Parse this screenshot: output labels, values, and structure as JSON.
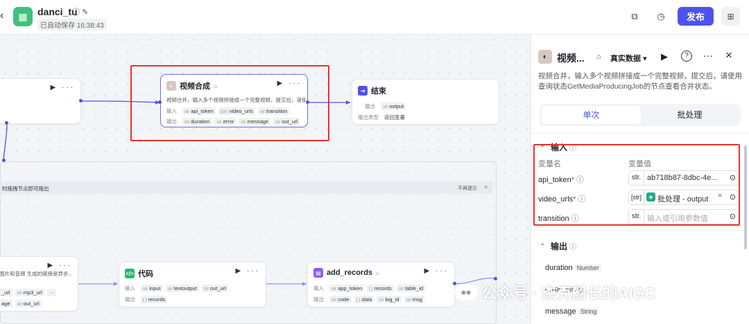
{
  "header": {
    "app_name": "danci_tu",
    "autosave": "已自动保存 16:38:43",
    "publish": "发布",
    "info_glyph": "ⓘ",
    "edit_glyph": "✎"
  },
  "canvas": {
    "hint": "时拖拽节点即可拖出",
    "hint_close": "不再提示",
    "video_node": {
      "title": "视频合成",
      "desc": "视频合并，输入多个视频拼接成一个完整视频，提交后，请使...",
      "in_label": "输入",
      "out_label": "输出",
      "inputs": [
        {
          "type": "str",
          "name": "api_token"
        },
        {
          "type": "[str]",
          "name": "video_urls"
        },
        {
          "type": "str",
          "name": "transition"
        }
      ],
      "outputs": [
        {
          "type": "Int",
          "name": "duration"
        },
        {
          "type": "str",
          "name": "error"
        },
        {
          "type": "str",
          "name": "message"
        },
        {
          "type": "str",
          "name": "out_url"
        }
      ]
    },
    "end_node": {
      "title": "结束",
      "out_label": "输出",
      "out_tag_type": "str",
      "out_tag": "output",
      "type_label": "输出类型",
      "type_value": "返回变量"
    },
    "code_node": {
      "title": "代码",
      "in_label": "输入",
      "out_label": "输出",
      "inputs": [
        {
          "type": "str",
          "name": "input"
        },
        {
          "type": "str",
          "name": "textoutput"
        },
        {
          "type": "str",
          "name": "out_url"
        }
      ],
      "outputs": [
        {
          "type": "[ ]",
          "name": "records"
        }
      ]
    },
    "records_node": {
      "title": "add_records",
      "in_label": "输入",
      "out_label": "输出",
      "inputs": [
        {
          "type": "str",
          "name": "app_token"
        },
        {
          "type": "[ ]",
          "name": "records"
        },
        {
          "type": "str",
          "name": "table_id"
        }
      ],
      "outputs": [
        {
          "type": "Int",
          "name": "code"
        },
        {
          "type": "{ }",
          "name": "data"
        },
        {
          "type": "str",
          "name": "log_id"
        },
        {
          "type": "str",
          "name": "msg"
        }
      ]
    },
    "left_node": {
      "desc": "图片和音频 生成的链接是异步...",
      "row1": [
        {
          "type": "",
          "name": "_url"
        },
        {
          "type": "str",
          "name": "mp3_url"
        }
      ],
      "row2": [
        {
          "type": "",
          "name": "age"
        },
        {
          "type": "str",
          "name": "out_url"
        }
      ]
    }
  },
  "panel": {
    "title": "视频...",
    "data_mode": "真实数据",
    "desc": "视频合并，输入多个视频拼接成一个完整视频，提交后，请使用查询状态GetMediaProducingJob的节点查看合并状态。",
    "tabs": [
      "单次",
      "批处理"
    ],
    "input_section": "输入",
    "col_name": "变量名",
    "col_value": "变量值",
    "inputs": [
      {
        "name": "api_token",
        "required": "*",
        "type": "str.",
        "value": "ab718b87-8dbc-4e...",
        "placeholder": ""
      },
      {
        "name": "video_urls",
        "required": "*",
        "type": "[str]",
        "value": "批处理 - output",
        "placeholder": ""
      },
      {
        "name": "transition",
        "required": "",
        "type": "str.",
        "value": "",
        "placeholder": "输入或引用参数值"
      }
    ],
    "output_section": "输出",
    "outputs": [
      {
        "name": "duration",
        "type": "Number"
      },
      {
        "name": "error",
        "type": "String"
      },
      {
        "name": "message",
        "type": "String"
      }
    ]
  },
  "watermark": "公众号 · 杰克船长的AIGC"
}
